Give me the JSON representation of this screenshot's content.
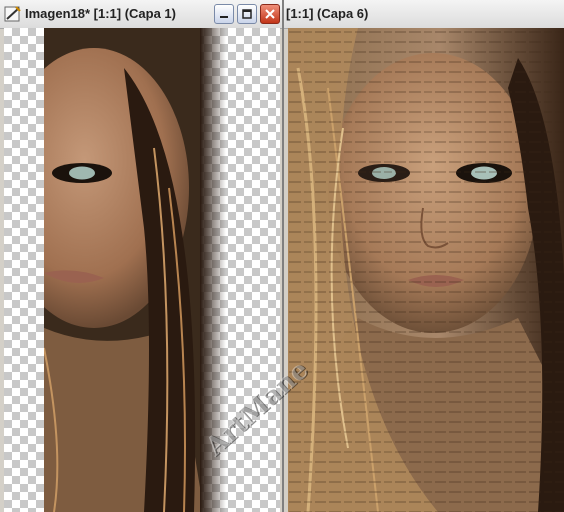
{
  "window1": {
    "title": "Imagen18* [1:1] (Capa 1)",
    "buttons": {
      "minimize": "minimize",
      "maximize": "maximize",
      "close": "close"
    }
  },
  "window2": {
    "title": "[1:1] (Capa 6)"
  },
  "watermark": "ArtMane",
  "colors": {
    "checker_light": "#ffffff",
    "checker_dark": "#c8c8c8",
    "close_red": "#c23418",
    "skin": "#b88d6a",
    "hair_dark": "#2a1a10"
  },
  "icons": [
    "app-icon",
    "minimize-icon",
    "maximize-icon",
    "close-icon"
  ]
}
